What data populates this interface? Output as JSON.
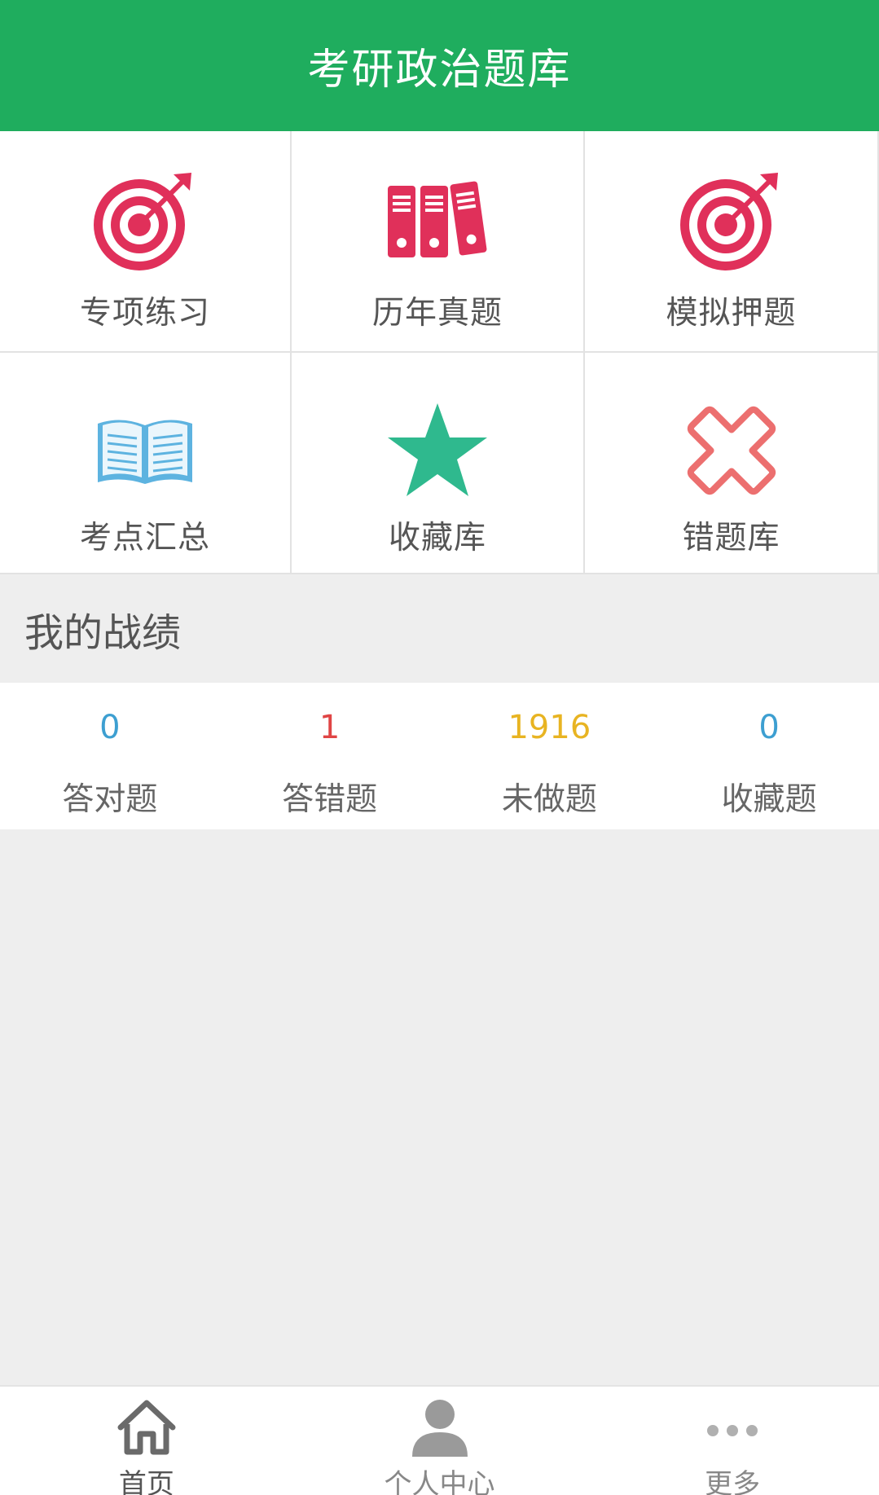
{
  "header": {
    "title": "考研政治题库"
  },
  "colors": {
    "header_bg": "#1fad5e",
    "target_red": "#e0305a",
    "book_blue": "#5db3e0",
    "star_green": "#2fb98e",
    "cross_red": "#ec6f6f",
    "stat_blue": "#3d9fd1",
    "stat_red": "#e04545",
    "stat_yellow": "#e8b422"
  },
  "menu": {
    "items": [
      {
        "label": "专项练习",
        "icon": "target-icon"
      },
      {
        "label": "历年真题",
        "icon": "binders-icon"
      },
      {
        "label": "模拟押题",
        "icon": "target-icon"
      },
      {
        "label": "考点汇总",
        "icon": "open-book-icon"
      },
      {
        "label": "收藏库",
        "icon": "star-icon"
      },
      {
        "label": "错题库",
        "icon": "cross-icon"
      }
    ]
  },
  "record": {
    "title": "我的战绩",
    "stats": [
      {
        "value": "0",
        "caption": "答对题"
      },
      {
        "value": "1",
        "caption": "答错题"
      },
      {
        "value": "1916",
        "caption": "未做题"
      },
      {
        "value": "0",
        "caption": "收藏题"
      }
    ]
  },
  "tabbar": {
    "tabs": [
      {
        "label": "首页",
        "icon": "home-icon"
      },
      {
        "label": "个人中心",
        "icon": "person-icon"
      },
      {
        "label": "更多",
        "icon": "more-icon"
      }
    ]
  }
}
